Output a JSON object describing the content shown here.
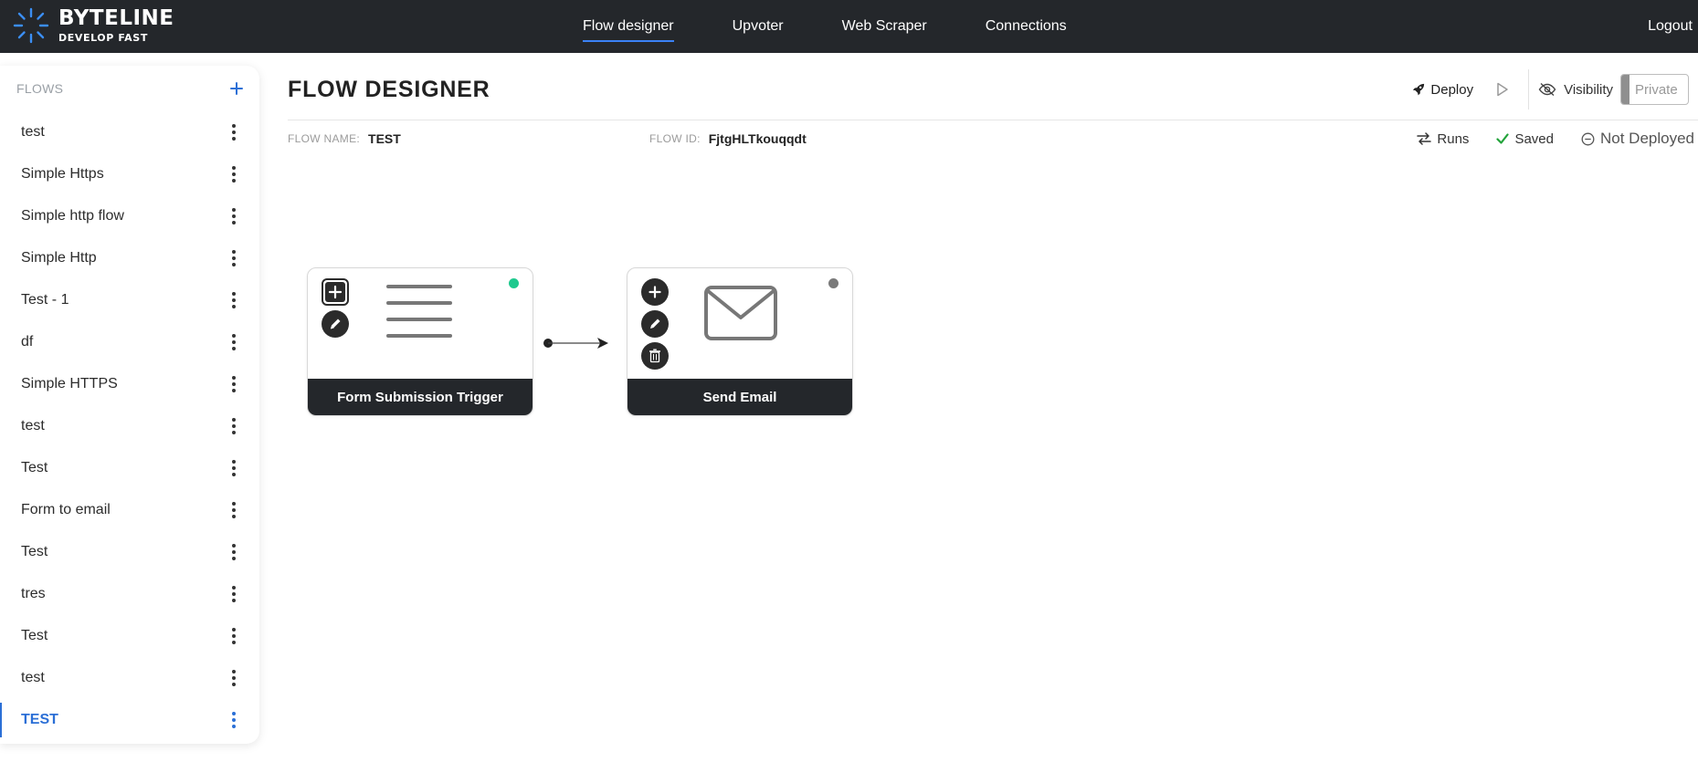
{
  "brand": {
    "name": "BYTELINE",
    "tagline": "DEVELOP FAST"
  },
  "nav": {
    "links": [
      {
        "label": "Flow designer",
        "active": true
      },
      {
        "label": "Upvoter",
        "active": false
      },
      {
        "label": "Web Scraper",
        "active": false
      },
      {
        "label": "Connections",
        "active": false
      }
    ],
    "logout": "Logout"
  },
  "sidebar": {
    "title": "FLOWS",
    "add_icon": "plus-icon",
    "items": [
      {
        "label": "test"
      },
      {
        "label": "Simple Https"
      },
      {
        "label": "Simple http flow"
      },
      {
        "label": "Simple Http"
      },
      {
        "label": "Test - 1"
      },
      {
        "label": "df"
      },
      {
        "label": "Simple HTTPS"
      },
      {
        "label": "test"
      },
      {
        "label": "Test"
      },
      {
        "label": "Form to email"
      },
      {
        "label": "Test"
      },
      {
        "label": "tres"
      },
      {
        "label": "Test"
      },
      {
        "label": "test"
      },
      {
        "label": "TEST",
        "active": true
      }
    ]
  },
  "main": {
    "title": "FLOW DESIGNER",
    "deploy_label": "Deploy",
    "visibility_label": "Visibility",
    "private_label": "Private",
    "flow_name_label": "FLOW NAME:",
    "flow_name_value": "TEST",
    "flow_id_label": "FLOW ID:",
    "flow_id_value": "FjtgHLTkouqqdt",
    "runs_label": "Runs",
    "saved_label": "Saved",
    "deploy_status": "Not Deployed"
  },
  "nodes": {
    "trigger": {
      "title": "Form Submission Trigger",
      "status_color": "#1fc98e",
      "icon": "form-lines-icon"
    },
    "action": {
      "title": "Send Email",
      "status_color": "#7a7a7a",
      "icon": "envelope-icon"
    }
  },
  "colors": {
    "accent": "#2b6fd6",
    "navbar": "#24272b",
    "saved": "#22a33a"
  }
}
